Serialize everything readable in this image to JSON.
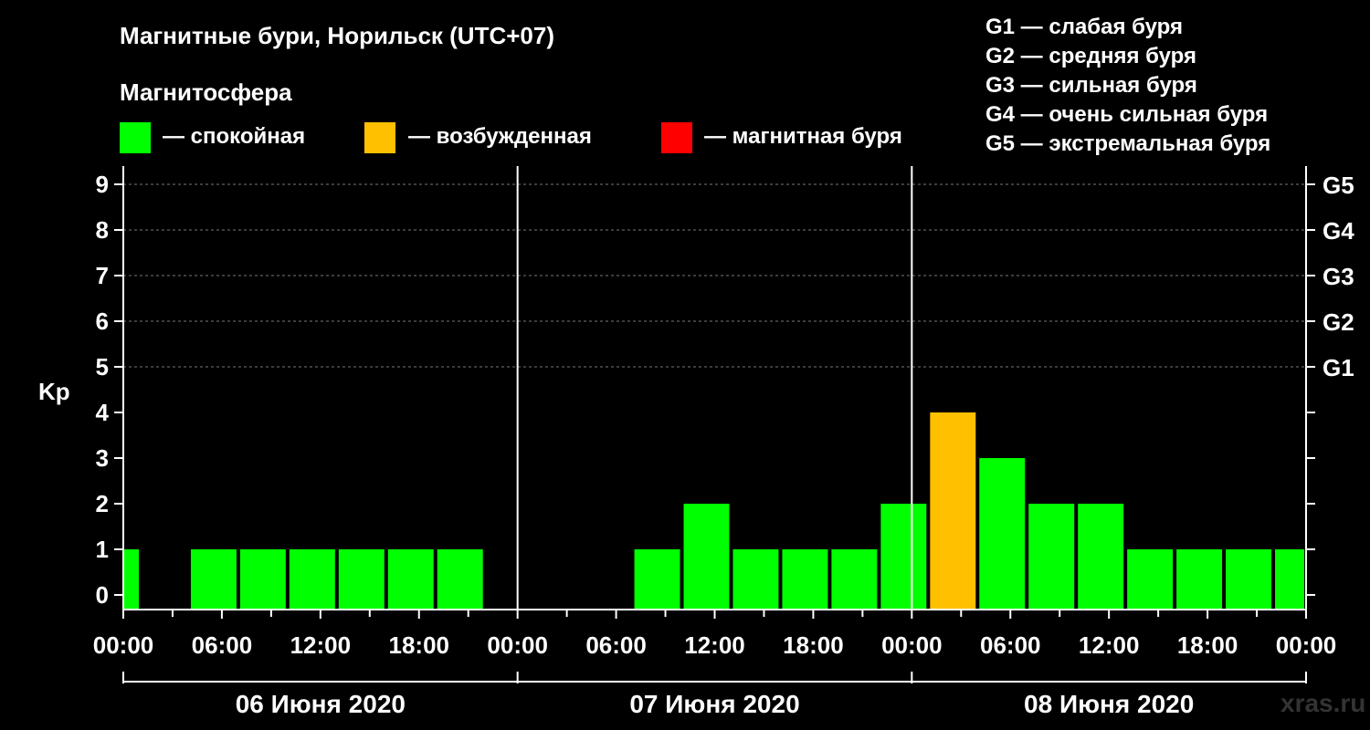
{
  "title": "Магнитные бури, Норильск (UTC+07)",
  "magnetosphere_label": "Магнитосфера",
  "status_legend": [
    {
      "color": "#00ff00",
      "label": "— спокойная"
    },
    {
      "color": "#ffc000",
      "label": "— возбужденная"
    },
    {
      "color": "#ff0000",
      "label": "— магнитная буря"
    }
  ],
  "g_legend": [
    "G1 — слабая буря",
    "G2 — средняя буря",
    "G3 — сильная буря",
    "G4 — очень сильная буря",
    "G5 — экстремальная буря"
  ],
  "watermark": "xras.ru",
  "colors": {
    "quiet": "#00ff00",
    "excited": "#ffc000",
    "storm": "#ff0000",
    "grid": "#777777",
    "background": "#000000"
  },
  "chart_data": {
    "type": "bar",
    "ylabel": "Kp",
    "ylim": [
      0,
      9
    ],
    "yticks": [
      0,
      1,
      2,
      3,
      4,
      5,
      6,
      7,
      8,
      9
    ],
    "right_axis_labels": [
      {
        "kp": 5,
        "label": "G1"
      },
      {
        "kp": 6,
        "label": "G2"
      },
      {
        "kp": 7,
        "label": "G3"
      },
      {
        "kp": 8,
        "label": "G4"
      },
      {
        "kp": 9,
        "label": "G5"
      }
    ],
    "grid": "dashed at Kp 5–9",
    "x_tick_labels": [
      "00:00",
      "06:00",
      "12:00",
      "18:00",
      "00:00",
      "06:00",
      "12:00",
      "18:00",
      "00:00",
      "06:00",
      "12:00",
      "18:00",
      "00:00"
    ],
    "days": [
      "06 Июня 2020",
      "07 Июня 2020",
      "08 Июня 2020"
    ],
    "bars": [
      {
        "start": "2020-06-06 00:00",
        "end": "2020-06-06 01:00",
        "kp": 1,
        "status": "quiet"
      },
      {
        "start": "2020-06-06 04:00",
        "end": "2020-06-06 07:00",
        "kp": 1,
        "status": "quiet"
      },
      {
        "start": "2020-06-06 07:00",
        "end": "2020-06-06 10:00",
        "kp": 1,
        "status": "quiet"
      },
      {
        "start": "2020-06-06 10:00",
        "end": "2020-06-06 13:00",
        "kp": 1,
        "status": "quiet"
      },
      {
        "start": "2020-06-06 13:00",
        "end": "2020-06-06 16:00",
        "kp": 1,
        "status": "quiet"
      },
      {
        "start": "2020-06-06 16:00",
        "end": "2020-06-06 19:00",
        "kp": 1,
        "status": "quiet"
      },
      {
        "start": "2020-06-06 19:00",
        "end": "2020-06-06 22:00",
        "kp": 1,
        "status": "quiet"
      },
      {
        "start": "2020-06-07 07:00",
        "end": "2020-06-07 10:00",
        "kp": 1,
        "status": "quiet"
      },
      {
        "start": "2020-06-07 10:00",
        "end": "2020-06-07 13:00",
        "kp": 2,
        "status": "quiet"
      },
      {
        "start": "2020-06-07 13:00",
        "end": "2020-06-07 16:00",
        "kp": 1,
        "status": "quiet"
      },
      {
        "start": "2020-06-07 16:00",
        "end": "2020-06-07 19:00",
        "kp": 1,
        "status": "quiet"
      },
      {
        "start": "2020-06-07 19:00",
        "end": "2020-06-07 22:00",
        "kp": 1,
        "status": "quiet"
      },
      {
        "start": "2020-06-07 22:00",
        "end": "2020-06-08 01:00",
        "kp": 2,
        "status": "quiet"
      },
      {
        "start": "2020-06-08 01:00",
        "end": "2020-06-08 04:00",
        "kp": 4,
        "status": "excited"
      },
      {
        "start": "2020-06-08 04:00",
        "end": "2020-06-08 07:00",
        "kp": 3,
        "status": "quiet"
      },
      {
        "start": "2020-06-08 07:00",
        "end": "2020-06-08 10:00",
        "kp": 2,
        "status": "quiet"
      },
      {
        "start": "2020-06-08 10:00",
        "end": "2020-06-08 13:00",
        "kp": 2,
        "status": "quiet"
      },
      {
        "start": "2020-06-08 13:00",
        "end": "2020-06-08 16:00",
        "kp": 1,
        "status": "quiet"
      },
      {
        "start": "2020-06-08 16:00",
        "end": "2020-06-08 19:00",
        "kp": 1,
        "status": "quiet"
      },
      {
        "start": "2020-06-08 19:00",
        "end": "2020-06-08 22:00",
        "kp": 1,
        "status": "quiet"
      },
      {
        "start": "2020-06-08 22:00",
        "end": "2020-06-09 00:00",
        "kp": 1,
        "status": "quiet"
      }
    ]
  }
}
